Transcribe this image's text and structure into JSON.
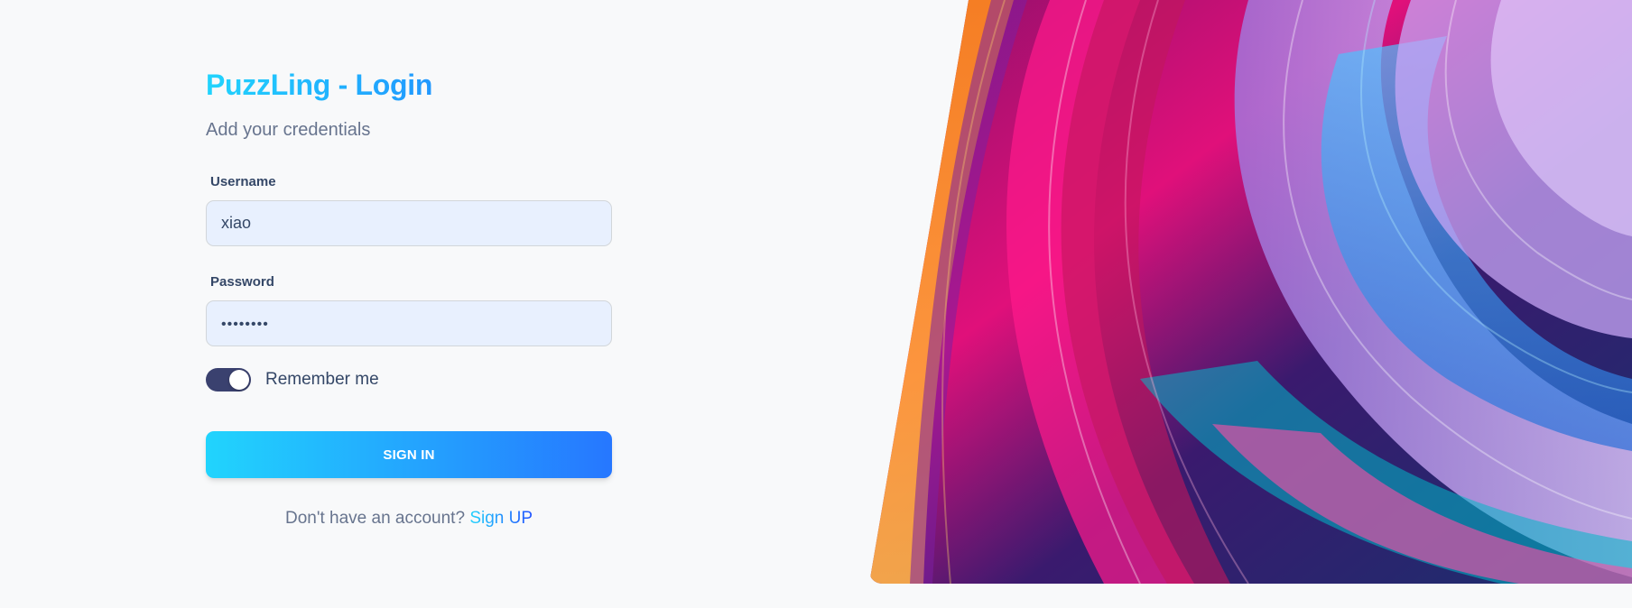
{
  "login": {
    "title": "PuzzLing - Login",
    "subtitle": "Add your credentials",
    "username": {
      "label": "Username",
      "value": "xiao"
    },
    "password": {
      "label": "Password",
      "masked_value": "••••••••"
    },
    "remember": {
      "label": "Remember me",
      "enabled": true
    },
    "sign_in_label": "SIGN IN",
    "signup_prompt": "Don't have an account?",
    "signup_link": "Sign UP"
  },
  "colors": {
    "accent_start": "#21d4fd",
    "accent_end": "#2152ff",
    "toggle_on": "#3a416f",
    "input_bg": "#e8f0fe",
    "page_bg": "#f8f9fa"
  },
  "decoration": {
    "image_icon": "abstract-swirl-art"
  }
}
